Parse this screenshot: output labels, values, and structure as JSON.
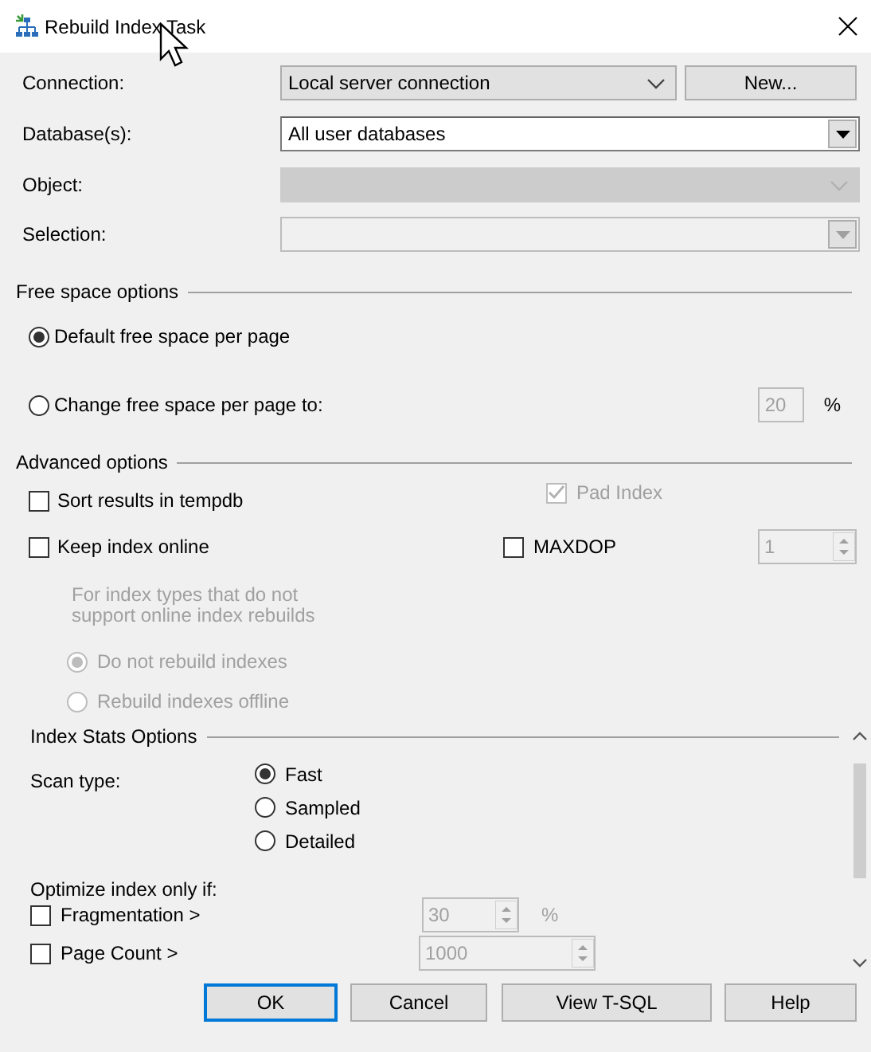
{
  "window": {
    "title": "Rebuild Index Task"
  },
  "fields": [
    {
      "label": "Connection:",
      "value": "Local server connection",
      "kind": "flat",
      "disabled": false,
      "button": "New..."
    },
    {
      "label": "Database(s):",
      "value": "All user databases",
      "kind": "classic",
      "disabled": false
    },
    {
      "label": "Object:",
      "kind": "flat",
      "disabled": true
    },
    {
      "label": "Selection:",
      "kind": "classic",
      "disabled": true
    }
  ],
  "free_space": {
    "title": "Free space options",
    "options": [
      {
        "label": "Default free space per page",
        "selected": true
      },
      {
        "label": "Change free space per page to:",
        "selected": false
      }
    ],
    "value": "20",
    "unit": "%"
  },
  "advanced": {
    "title": "Advanced options",
    "sort_in_tempdb": {
      "label": "Sort results in tempdb",
      "checked": false
    },
    "pad_index": {
      "label": "Pad Index",
      "checked": true,
      "disabled": true
    },
    "keep_online": {
      "label": "Keep index online",
      "checked": false
    },
    "maxdop": {
      "label": "MAXDOP",
      "checked": false,
      "value": "1"
    },
    "note": "For index types that do not\nsupport online index rebuilds",
    "offline_options": [
      {
        "label": "Do not rebuild indexes",
        "selected": true
      },
      {
        "label": "Rebuild indexes offline",
        "selected": false
      }
    ]
  },
  "stats": {
    "title": "Index Stats Options",
    "scan_label": "Scan type:",
    "scan_types": [
      {
        "label": "Fast",
        "selected": true
      },
      {
        "label": "Sampled",
        "selected": false
      },
      {
        "label": "Detailed",
        "selected": false
      }
    ],
    "optimize_label": "Optimize index only if:",
    "conditions": [
      {
        "label": "Fragmentation >",
        "checked": false,
        "value": "30",
        "unit": "%"
      },
      {
        "label": "Page Count >",
        "checked": false,
        "value": "1000"
      }
    ]
  },
  "buttons": [
    {
      "label": "OK",
      "default": true
    },
    {
      "label": "Cancel",
      "default": false
    },
    {
      "label": "View T-SQL",
      "default": false
    },
    {
      "label": "Help",
      "default": false
    }
  ]
}
